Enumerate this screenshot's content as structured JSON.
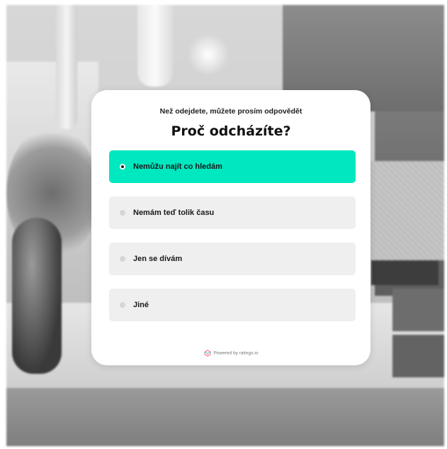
{
  "survey": {
    "subtitle": "Než odejdete, můžete prosím odpovědět",
    "title": "Proč odcházíte?",
    "options": [
      {
        "label": "Nemůžu najít co hledám",
        "selected": true
      },
      {
        "label": "Nemám teď tolik času",
        "selected": false
      },
      {
        "label": "Jen se dívám",
        "selected": false
      },
      {
        "label": "Jiné",
        "selected": false
      }
    ],
    "footer": "Powered by ratingo.io"
  },
  "colors": {
    "selected_option": "#00e8c0",
    "option_background": "#efefef",
    "card_background": "#ffffff"
  },
  "icons": {
    "footer_logo": "ratingo-logo-icon",
    "option_indicator": "radio-icon"
  }
}
